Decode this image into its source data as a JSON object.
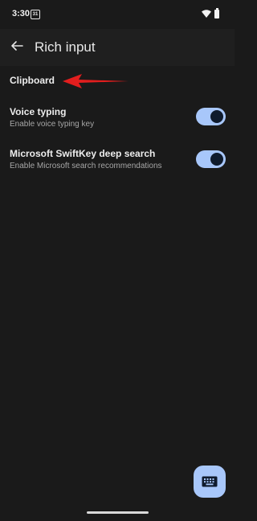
{
  "status_bar": {
    "time": "3:30",
    "calendar_day": "31",
    "wifi_icon": "wifi-icon",
    "battery_icon": "battery-icon"
  },
  "app_bar": {
    "back_icon": "arrow-back-icon",
    "title": "Rich input"
  },
  "section": {
    "clipboard_label": "Clipboard",
    "annotation_color": "#e31e1e"
  },
  "preferences": [
    {
      "title": "Voice typing",
      "summary": "Enable voice typing key",
      "enabled": true
    },
    {
      "title": "Microsoft SwiftKey deep search",
      "summary": "Enable Microsoft search recommendations",
      "enabled": true
    }
  ],
  "fab": {
    "icon": "keyboard-icon"
  },
  "colors": {
    "background": "#1a1a1a",
    "toggle_track": "#a8c7fa",
    "toggle_thumb": "#0f1b2d"
  }
}
